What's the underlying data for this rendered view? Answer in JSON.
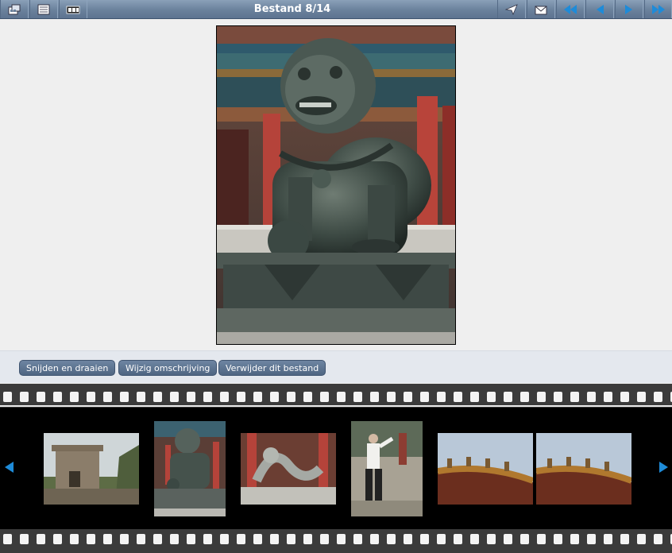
{
  "toolbar": {
    "title": "Bestand 8/14",
    "left_buttons": [
      "gallery-icon",
      "list-icon",
      "slideshow-icon"
    ],
    "right_buttons": [
      "send-icon",
      "mail-icon",
      "first-icon",
      "previous-icon",
      "next-icon",
      "last-icon"
    ]
  },
  "actions": {
    "crop_rotate": "Snijden en draaien",
    "edit_description": "Wijzig omschrijving",
    "delete_file": "Verwijder dit bestand"
  },
  "filmstrip": {
    "thumbnails": [
      {
        "subject": "great-wall",
        "selected": false
      },
      {
        "subject": "lion-statue",
        "selected": true
      },
      {
        "subject": "dragon-statue",
        "selected": false
      },
      {
        "subject": "tai-chi",
        "selected": false
      },
      {
        "subject": "roof-ornament",
        "selected": false
      },
      {
        "subject": "roof-ornament",
        "selected": false
      }
    ]
  },
  "colors": {
    "toolbar": "#6a819c",
    "accent_arrow": "#1e8bd8",
    "button": "#5a7190",
    "film": "#000000"
  }
}
